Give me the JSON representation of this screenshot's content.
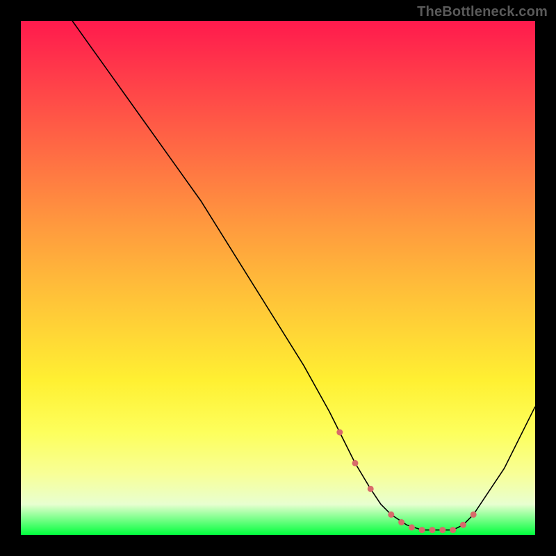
{
  "watermark": "TheBottleneck.com",
  "chart_data": {
    "type": "line",
    "title": "",
    "xlabel": "",
    "ylabel": "",
    "xlim": [
      0,
      100
    ],
    "ylim": [
      0,
      100
    ],
    "series": [
      {
        "name": "bottleneck-curve",
        "x": [
          10,
          15,
          20,
          25,
          30,
          35,
          40,
          45,
          50,
          55,
          60,
          62,
          65,
          68,
          70,
          72,
          75,
          78,
          80,
          82,
          84,
          86,
          88,
          90,
          94,
          100
        ],
        "y": [
          100,
          93,
          86,
          79,
          72,
          65,
          57,
          49,
          41,
          33,
          24,
          20,
          14,
          9,
          6,
          4,
          2,
          1,
          1,
          1,
          1,
          2,
          4,
          7,
          13,
          25
        ]
      }
    ],
    "markers": {
      "name": "highlight-dots",
      "x": [
        62,
        65,
        68,
        72,
        74,
        76,
        78,
        80,
        82,
        84,
        86,
        88
      ],
      "y": [
        20,
        14,
        9,
        4,
        2.5,
        1.5,
        1,
        1,
        1,
        1,
        2,
        4
      ]
    },
    "background_gradient": {
      "top_color": "#ff1a4d",
      "bottom_color": "#00ff3c",
      "description": "vertical red-orange-yellow-green gradient"
    }
  }
}
